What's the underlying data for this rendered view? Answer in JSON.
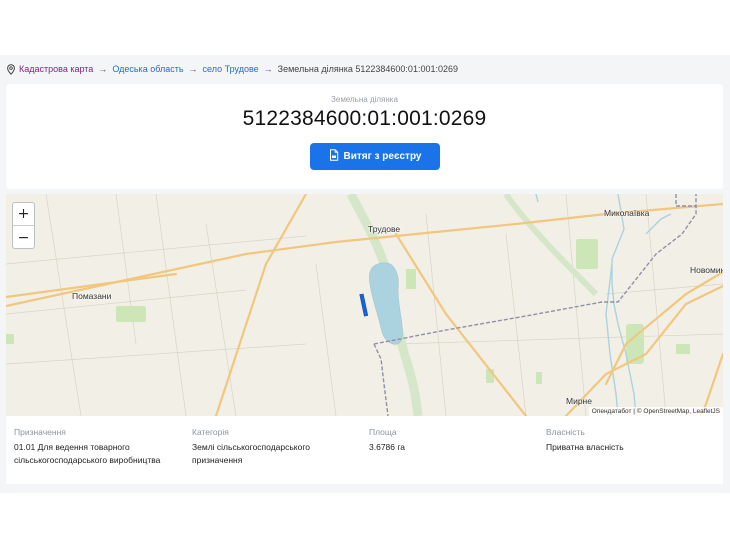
{
  "breadcrumb": {
    "items": [
      "Кадастрова карта",
      "Одеська область",
      "село Трудове"
    ],
    "separator": "→",
    "current": "Земельна ділянка 5122384600:01:001:0269"
  },
  "header": {
    "subtitle": "Земельна ділянка",
    "cadastral_number": "5122384600:01:001:0269",
    "extract_button": "Витяг з реєстру"
  },
  "map": {
    "zoom_in": "+",
    "zoom_out": "−",
    "places": [
      "Трудове",
      "Миколаївка",
      "Помазани",
      "Новомин",
      "Мирне"
    ],
    "attribution": "Опендатабот | © OpenStreetMap, LeafletJS"
  },
  "info": [
    {
      "label": "Призначення",
      "value": "01.01 Для ведення товарного сільськогосподарського виробництва"
    },
    {
      "label": "Категорія",
      "value": "Землі сільськогосподарського призначення"
    },
    {
      "label": "Площа",
      "value": "3.6786 га"
    },
    {
      "label": "Власність",
      "value": "Приватна власність"
    }
  ],
  "colors": {
    "link": "#1f6fd1",
    "first_link": "#8a1f7a",
    "button": "#1a73e8",
    "parcel": "#1565e0",
    "water": "#aad3df",
    "road": "#f1c77e",
    "border": "#8f8fa8"
  }
}
